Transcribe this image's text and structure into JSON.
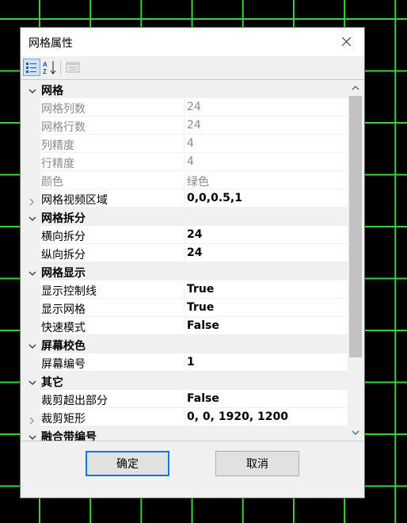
{
  "dialog": {
    "title": "网格属性",
    "close_icon": "close-icon"
  },
  "toolbar": {
    "buttons": [
      {
        "icon": "categorized-view-icon",
        "active": true
      },
      {
        "icon": "sort-alphabetical-icon",
        "active": false
      },
      {
        "icon": "property-pages-icon",
        "active": false,
        "disabled": true
      }
    ]
  },
  "property_grid": {
    "categories": [
      {
        "label": "网格",
        "expanded": true,
        "properties": [
          {
            "name": "网格列数",
            "value": "24",
            "readonly": true
          },
          {
            "name": "网格行数",
            "value": "24",
            "readonly": true
          },
          {
            "name": "列精度",
            "value": "4",
            "readonly": true
          },
          {
            "name": "行精度",
            "value": "4",
            "readonly": true
          },
          {
            "name": "颜色",
            "value": "绿色",
            "readonly": true
          },
          {
            "name": "网格视频区域",
            "value": "0,0,0.5,1",
            "readonly": false,
            "expandable": true
          }
        ]
      },
      {
        "label": "网格拆分",
        "expanded": true,
        "properties": [
          {
            "name": "横向拆分",
            "value": "24",
            "readonly": false
          },
          {
            "name": "纵向拆分",
            "value": "24",
            "readonly": false
          }
        ]
      },
      {
        "label": "网格显示",
        "expanded": true,
        "properties": [
          {
            "name": "显示控制线",
            "value": "True",
            "readonly": false
          },
          {
            "name": "显示网格",
            "value": "True",
            "readonly": false
          },
          {
            "name": "快速模式",
            "value": "False",
            "readonly": false
          }
        ]
      },
      {
        "label": "屏幕校色",
        "expanded": true,
        "properties": [
          {
            "name": "屏幕编号",
            "value": "1",
            "readonly": false
          }
        ]
      },
      {
        "label": "其它",
        "expanded": true,
        "properties": [
          {
            "name": "裁剪超出部分",
            "value": "False",
            "readonly": false
          },
          {
            "name": "裁剪矩形",
            "value": "0, 0, 1920, 1200",
            "readonly": false,
            "expandable": true
          }
        ]
      },
      {
        "label": "融合带编号",
        "expanded": true,
        "properties": []
      }
    ]
  },
  "buttons": {
    "ok_label": "确定",
    "cancel_label": "取消"
  },
  "colors": {
    "background": "#000000",
    "grid_line": "#3ecf3e",
    "accent": "#0078d7",
    "readonly_text": "#8a8a8a"
  }
}
